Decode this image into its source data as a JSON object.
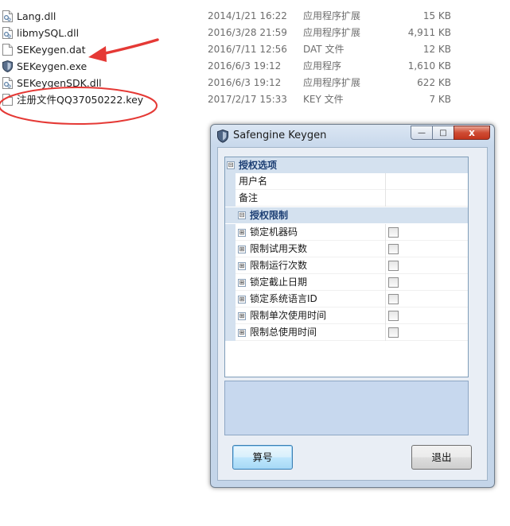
{
  "files": [
    {
      "icon": "dll-file-icon",
      "name": "Lang.dll",
      "date": "2014/1/21 16:22",
      "type": "应用程序扩展",
      "size": "15 KB"
    },
    {
      "icon": "dll-file-icon",
      "name": "libmySQL.dll",
      "date": "2016/3/28 21:59",
      "type": "应用程序扩展",
      "size": "4,911 KB"
    },
    {
      "icon": "blank-file-icon",
      "name": "SEKeygen.dat",
      "date": "2016/7/11 12:56",
      "type": "DAT 文件",
      "size": "12 KB"
    },
    {
      "icon": "shield-exe-icon",
      "name": "SEKeygen.exe",
      "date": "2016/6/3 19:12",
      "type": "应用程序",
      "size": "1,610 KB"
    },
    {
      "icon": "dll-file-icon",
      "name": "SEKeygenSDK.dll",
      "date": "2016/6/3 19:12",
      "type": "应用程序扩展",
      "size": "622 KB"
    },
    {
      "icon": "blank-file-icon",
      "name": "注册文件QQ37050222.key",
      "date": "2017/2/17 15:33",
      "type": "KEY 文件",
      "size": "7 KB"
    }
  ],
  "annotation": {
    "arrow_color": "#e53935",
    "ellipse_color": "#e53935"
  },
  "dialog": {
    "title": "Safengine Keygen",
    "caption_buttons": {
      "minimize": "—",
      "maximize": "□",
      "close": "x"
    },
    "property_grid": {
      "category_main": "授权选项",
      "fields": [
        {
          "label": "用户名",
          "value": ""
        },
        {
          "label": "备注",
          "value": ""
        }
      ],
      "category_limits": "授权限制",
      "limits": [
        {
          "label": "锁定机器码",
          "checked": false
        },
        {
          "label": "限制试用天数",
          "checked": false
        },
        {
          "label": "限制运行次数",
          "checked": false
        },
        {
          "label": "锁定截止日期",
          "checked": false
        },
        {
          "label": "锁定系统语言ID",
          "checked": false
        },
        {
          "label": "限制单次使用时间",
          "checked": false
        },
        {
          "label": "限制总使用时间",
          "checked": false
        }
      ],
      "expander_symbol": "⊞",
      "collapse_symbol": "⊟"
    },
    "buttons": {
      "compute": "算号",
      "exit": "退出"
    }
  }
}
